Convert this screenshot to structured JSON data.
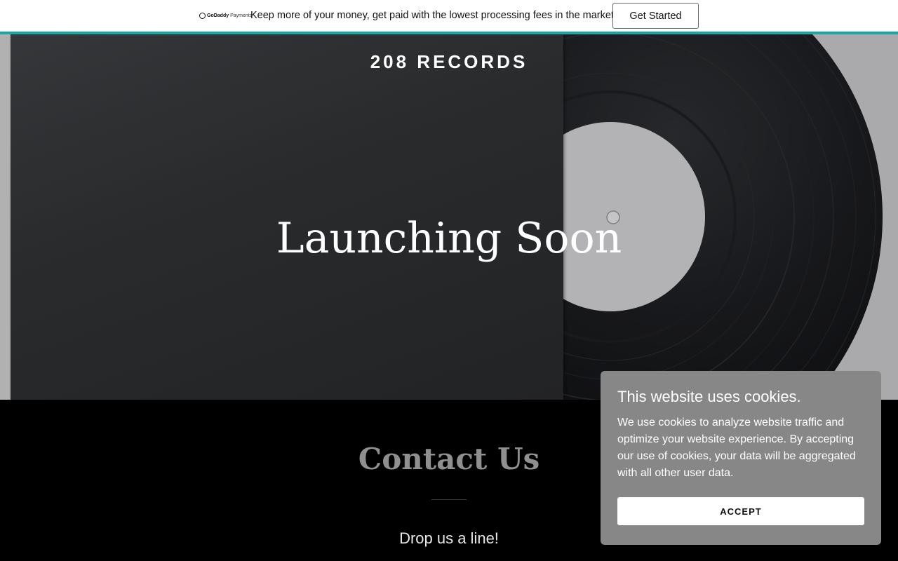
{
  "promo": {
    "logo_brand": "GoDaddy",
    "logo_product": "Payments",
    "message": "Keep more of your money, get paid with the lowest processing fees in the market.",
    "cta_label": "Get Started"
  },
  "hero": {
    "site_title": "208 RECORDS",
    "heading": "Launching Soon"
  },
  "contact": {
    "title": "Contact Us",
    "subtitle": "Drop us a line!"
  },
  "cookie_banner": {
    "title": "This website uses cookies.",
    "body": "We use cookies to analyze website traffic and optimize your website experience. By accepting our use of cookies, your data will be aggregated with all other user data.",
    "accept_label": "ACCEPT"
  },
  "colors": {
    "promo_accent": "#1ba5a3",
    "cookie_bg": "#878787",
    "contact_title": "#8f8f8f"
  }
}
